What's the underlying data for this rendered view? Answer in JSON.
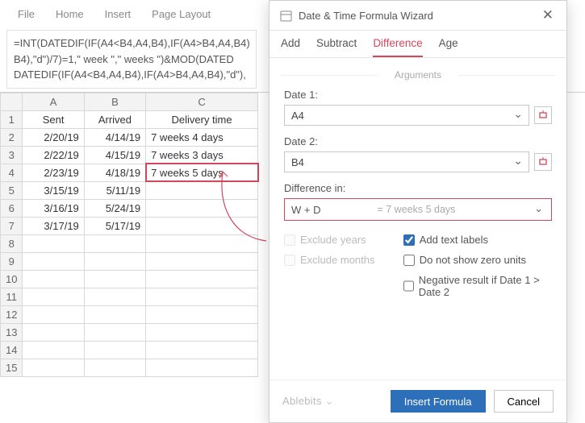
{
  "ribbon": [
    "File",
    "Home",
    "Insert",
    "Page Layout"
  ],
  "formula_bar": "=INT(DATEDIF(IF(A4<B4,A4,B4),IF(A4>B4,A4,B4)\nB4),\"d\")/7)=1,\" week \",\" weeks \")&MOD(DATED\nDATEDIF(IF(A4<B4,A4,B4),IF(A4>B4,A4,B4),\"d\"),",
  "columns": [
    "A",
    "B",
    "C"
  ],
  "rows": [
    "1",
    "2",
    "3",
    "4",
    "5",
    "6",
    "7",
    "8",
    "9",
    "10",
    "11",
    "12",
    "13",
    "14",
    "15"
  ],
  "grid": {
    "headerRow": [
      "Sent",
      "Arrived",
      "Delivery time"
    ],
    "dataRows": [
      [
        "2/20/19",
        "4/14/19",
        "7 weeks 4 days"
      ],
      [
        "2/22/19",
        "4/15/19",
        "7 weeks 3 days"
      ],
      [
        "2/23/19",
        "4/18/19",
        "7 weeks 5 days"
      ],
      [
        "3/15/19",
        "5/11/19",
        ""
      ],
      [
        "3/16/19",
        "5/24/19",
        ""
      ],
      [
        "3/17/19",
        "5/17/19",
        ""
      ]
    ]
  },
  "wizard": {
    "title": "Date & Time Formula Wizard",
    "tabs": [
      "Add",
      "Subtract",
      "Difference",
      "Age"
    ],
    "active_tab": "Difference",
    "arguments_label": "Arguments",
    "date1_label": "Date 1:",
    "date1_value": "A4",
    "date2_label": "Date 2:",
    "date2_value": "B4",
    "diffin_label": "Difference in:",
    "diffin_value": "W + D",
    "diffin_hint": "= 7 weeks 5 days",
    "checks": {
      "exclude_years": "Exclude years",
      "exclude_months": "Exclude months",
      "add_text_labels": "Add text labels",
      "no_zero_units": "Do not show zero units",
      "negative_result": "Negative result if Date 1 > Date 2"
    },
    "brand": "Ablebits",
    "insert_btn": "Insert Formula",
    "cancel_btn": "Cancel"
  }
}
